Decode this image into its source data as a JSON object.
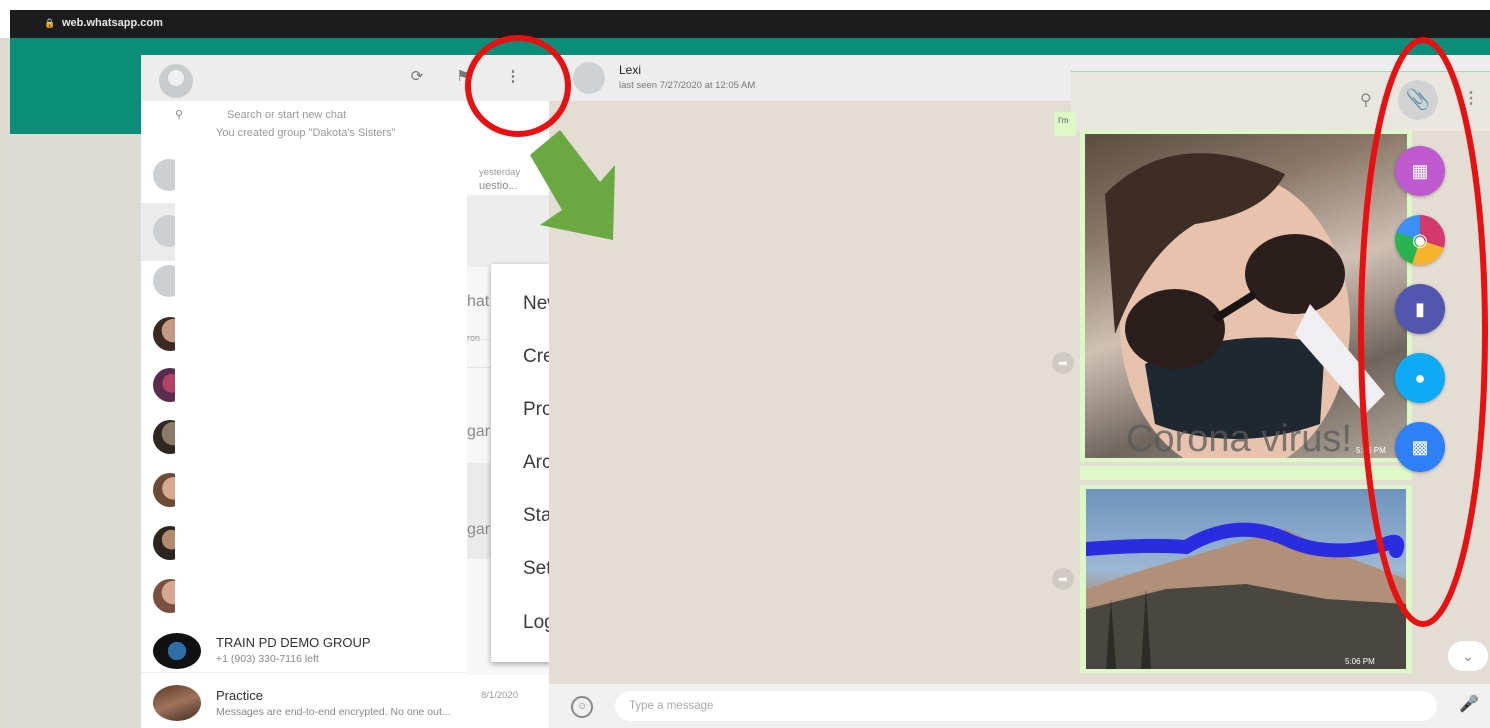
{
  "browser": {
    "url": "web.whatsapp.com"
  },
  "sidebar": {
    "search_placeholder": "Search or start new chat",
    "clipped_top_line": "You created group \"Dakota's Sisters\"",
    "clipped_time": "yesterday",
    "clipped_preview": "uestio...",
    "slivers": [
      "hat",
      "ron",
      "gar",
      "gar"
    ],
    "chats": [
      {
        "name": "TRAIN PD DEMO GROUP",
        "preview": "+1 (903) 330-7116 left",
        "time": ""
      },
      {
        "name": "Practice",
        "preview": "Messages are end-to-end encrypted. No one out...",
        "time": "8/1/2020"
      }
    ]
  },
  "menu": {
    "items": [
      "New group",
      "Create a room",
      "Profile",
      "Archived",
      "Starred",
      "Settings",
      "Log out"
    ]
  },
  "conversation": {
    "contact_name": "Lexi",
    "contact_status": "last seen 7/27/2020 at 12:05 AM",
    "msg_tag": "I'm",
    "image_caption": "Corona virus!",
    "image1_time": "5:06 PM",
    "image2_time": "5:06 PM",
    "input_placeholder": "Type a message"
  },
  "attach_menu": {
    "buttons": [
      {
        "name": "photos-videos",
        "color": "#bf59cf"
      },
      {
        "name": "camera",
        "color": "#d3396d"
      },
      {
        "name": "document",
        "color": "#5157ae"
      },
      {
        "name": "contact",
        "color": "#0eabf4"
      },
      {
        "name": "room",
        "color": "#2e7ff8"
      }
    ]
  },
  "colors": {
    "teal": "#0a8e79",
    "annotation_red": "#e81010",
    "annotation_green": "#6aa842",
    "highlight_blue": "#3b3fe0"
  }
}
